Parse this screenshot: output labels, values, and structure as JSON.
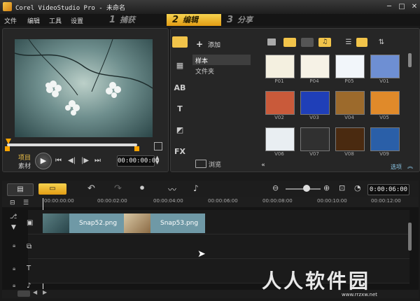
{
  "window": {
    "title": "Corel VideoStudio Pro - 未命名"
  },
  "menu": [
    "文件",
    "编辑",
    "工具",
    "设置"
  ],
  "steps": [
    {
      "num": "1",
      "label": "捕获",
      "active": false
    },
    {
      "num": "2",
      "label": "编辑",
      "active": true
    },
    {
      "num": "3",
      "label": "分享",
      "active": false
    }
  ],
  "preview": {
    "project_label": "项目",
    "clip_label": "素材",
    "timecode": "00:00:00:00"
  },
  "library": {
    "add_label": "添加",
    "folders": [
      {
        "label": "样本",
        "selected": true
      },
      {
        "label": "文件夹",
        "selected": false
      }
    ],
    "browse_label": "浏览",
    "options_label": "选项",
    "thumbs": [
      {
        "label": "P01",
        "color": "#f4f0e0"
      },
      {
        "label": "P04",
        "color": "#f6f2e6"
      },
      {
        "label": "P05",
        "color": "#f2f6fa"
      },
      {
        "label": "V01",
        "color": "#6e8fd3"
      },
      {
        "label": "V02",
        "color": "#c95a3a"
      },
      {
        "label": "V03",
        "color": "#1f3fb8"
      },
      {
        "label": "V04",
        "color": "#9c6a2c"
      },
      {
        "label": "V05",
        "color": "#e08a2a"
      },
      {
        "label": "V06",
        "color": "#e9eef2"
      },
      {
        "label": "V07",
        "color": "#303030"
      },
      {
        "label": "V08",
        "color": "#4a2a10"
      },
      {
        "label": "V09",
        "color": "#2a5fa8"
      }
    ]
  },
  "timeline": {
    "timecode": "0:00:06:00",
    "ruler": [
      "00:00:00:00",
      "00:00:02:00",
      "00:00:04:00",
      "00:00:06:00",
      "00:00:08:00",
      "00:00:10:00",
      "00:00:12:00"
    ],
    "clips": [
      {
        "label": "Snap52.png"
      },
      {
        "label": "Snap53.png"
      }
    ]
  },
  "watermark": {
    "text": "人人软件园",
    "url": "www.rrzxw.net"
  }
}
